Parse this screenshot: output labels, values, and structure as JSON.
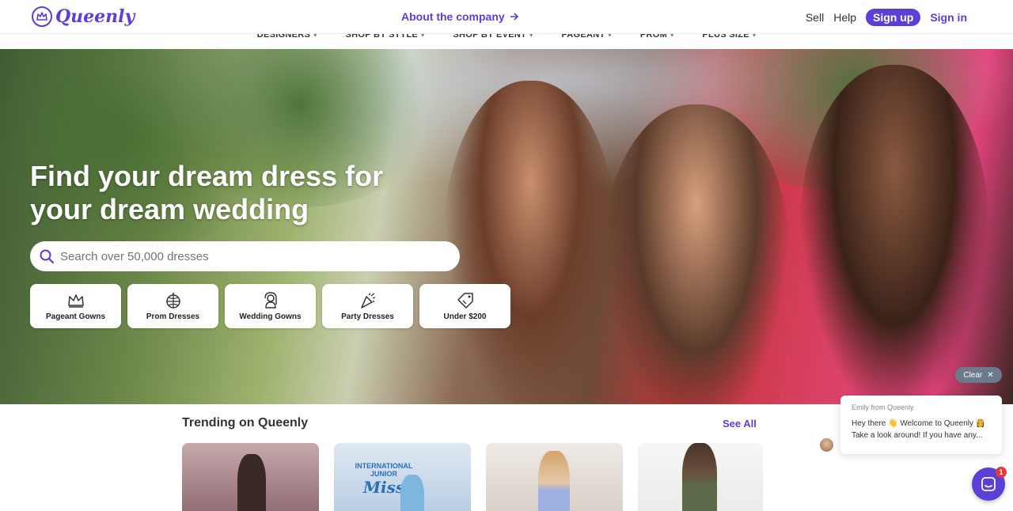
{
  "header": {
    "logo_text": "Queenly",
    "about_link": "About the company",
    "nav": {
      "sell": "Sell",
      "help": "Help",
      "signup": "Sign up",
      "signin": "Sign in"
    }
  },
  "categories": [
    {
      "label": "DESIGNERS"
    },
    {
      "label": "SHOP BY STYLE"
    },
    {
      "label": "SHOP BY EVENT"
    },
    {
      "label": "PAGEANT"
    },
    {
      "label": "PROM"
    },
    {
      "label": "PLUS SIZE"
    }
  ],
  "hero": {
    "title_line1": "Find your dream dress for",
    "title_line2": "your dream wedding",
    "search_placeholder": "Search over 50,000 dresses"
  },
  "quick_links": [
    {
      "label": "Pageant Gowns",
      "icon": "crown-icon"
    },
    {
      "label": "Prom Dresses",
      "icon": "disco-ball-icon"
    },
    {
      "label": "Wedding Gowns",
      "icon": "bride-icon"
    },
    {
      "label": "Party Dresses",
      "icon": "party-popper-icon"
    },
    {
      "label": "Under $200",
      "icon": "price-tag-icon"
    }
  ],
  "trending": {
    "title": "Trending on Queenly",
    "see_all": "See All",
    "card_text": {
      "badge_line1": "INTERNATIONAL",
      "badge_line2": "JUNIOR",
      "badge_line3": "Miss"
    }
  },
  "chat": {
    "clear_label": "Clear",
    "from": "Emily from Queenly",
    "line1": "Hey there 👋 Welcome to Queenly 👸",
    "line2": "Take a look around! If you have any...",
    "badge_count": "1"
  },
  "colors": {
    "brand": "#5b3fd6",
    "chat_badge": "#e03a3a"
  }
}
